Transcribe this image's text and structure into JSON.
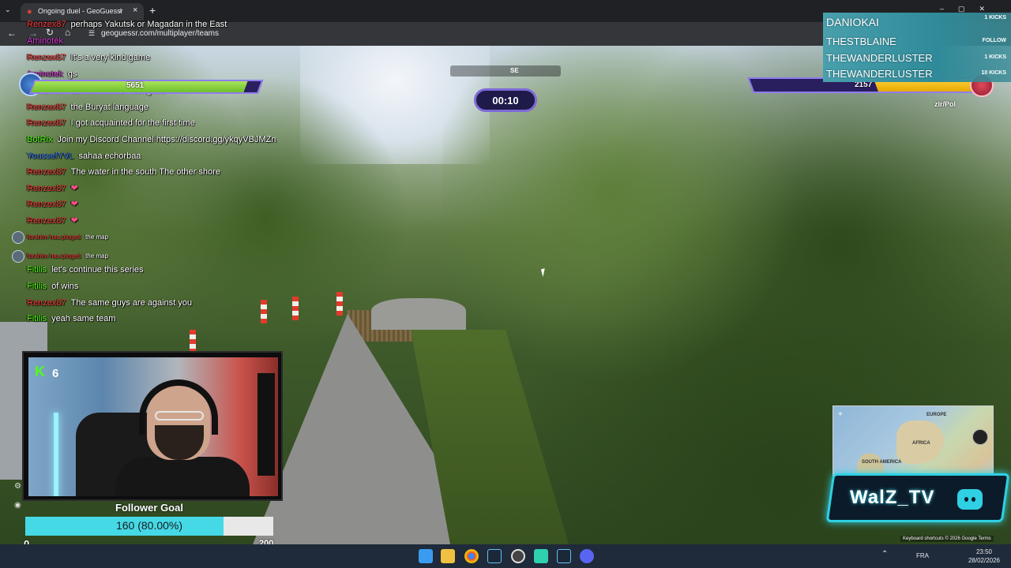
{
  "browser": {
    "tab_title": "Ongoing duel - GeoGuessr",
    "url": "geoguessr.com/multiplayer/teams"
  },
  "chat": [
    {
      "user": "Renzex87",
      "user_color": "#ff3b3b",
      "msg": "perhaps Yakutsk or Magadan in the East"
    },
    {
      "user": "Aminotek",
      "user_color": "#d93cd9",
      "msg": ""
    },
    {
      "user": "Renzex87",
      "user_color": "#ff3b3b",
      "msg": "It's a very kind game"
    },
    {
      "user": "Aminotek",
      "user_color": "#d93cd9",
      "msg": "gs"
    },
    {
      "user": "Renzex87",
      "user_color": "#ff3b3b",
      "msg": "Let him deliver Mongolia"
    },
    {
      "user": "Renzex87",
      "user_color": "#ff3b3b",
      "msg": "the Buryat language"
    },
    {
      "user": "Renzex87",
      "user_color": "#ff3b3b",
      "msg": "I got acquainted for the first time"
    },
    {
      "user": "BotRix",
      "user_color": "#53fc18",
      "msg": "Join my Discord Channel https://discord.gg/ykqyVBJMZn"
    },
    {
      "user": "YoussefYVL",
      "user_color": "#3b7dff",
      "msg": "sahaa echorbaa"
    },
    {
      "user": "Renzex87",
      "user_color": "#ff3b3b",
      "msg": "The water in the south The other shore"
    },
    {
      "user": "Renzex87",
      "user_color": "#ff3b3b",
      "msg": "❤"
    },
    {
      "user": "Renzex87",
      "user_color": "#ff3b3b",
      "msg": "❤"
    },
    {
      "user": "Renzex87",
      "user_color": "#ff3b3b",
      "msg": "❤"
    },
    {
      "user": "Ibrahim has pinged",
      "user_color": "#ff3b3b",
      "msg": "the map"
    },
    {
      "user": "Ibrahim has pinged",
      "user_color": "#ff3b3b",
      "msg": "the map"
    },
    {
      "user": "Fitilis",
      "user_color": "#53fc18",
      "msg": "let's continue this series"
    },
    {
      "user": "Fitilis",
      "user_color": "#53fc18",
      "msg": "of wins"
    },
    {
      "user": "Renzex87",
      "user_color": "#ff3b3b",
      "msg": "The same guys are against you"
    },
    {
      "user": "Fitilis",
      "user_color": "#53fc18",
      "msg": "yeah same team"
    }
  ],
  "game": {
    "left_hp": "5651",
    "left_hp_fraction": 0.94,
    "right_hp": "2157",
    "right_hp_fraction": 0.47,
    "right_team_tag": "zlr/Pol",
    "timer": "00:10",
    "compass_heading": "SE"
  },
  "kicks": {
    "rows": [
      {
        "name": "DANIOKAI",
        "badge": "1 KICKS"
      },
      {
        "name": "THESTBLAINE",
        "badge": "FOLLOW"
      },
      {
        "name": "THEWANDERLUSTER",
        "badge": "1 KICKS"
      },
      {
        "name": "THEWANDERLUSTER",
        "badge": "10 KICKS"
      }
    ]
  },
  "webcam": {
    "kick_count": "6"
  },
  "follower_goal": {
    "title": "Follower Goal",
    "progress_text": "160 (80.00%)",
    "fraction": 0.8,
    "min": "0",
    "max": "200"
  },
  "minimap": {
    "label_europe": "EUROPE",
    "label_africa": "AFRICA",
    "label_south_america": "SOUTH AMERICA",
    "footer": "Keyboard shortcuts  © 2026 Google  Terms"
  },
  "brand": {
    "name": "WalZ_TV"
  },
  "taskbar": {
    "language": "FRA",
    "time": "23:50",
    "date": "28/02/2026"
  },
  "colors": {
    "hp_left": "#8fd33f",
    "hp_right": "#ffd23a",
    "accent_purple": "#7d6bd6",
    "kick_green": "#53fc18",
    "brand_cyan": "#2fd0e3"
  }
}
